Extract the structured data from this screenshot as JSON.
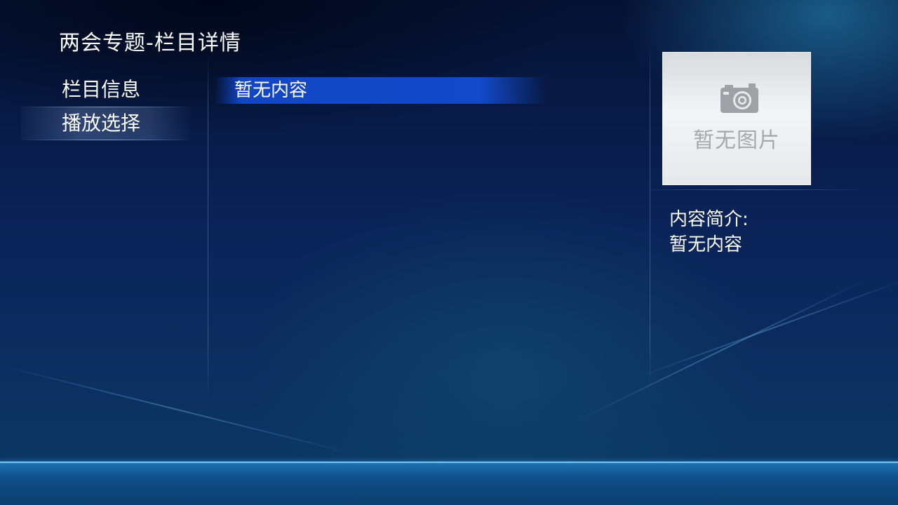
{
  "header": {
    "title": "两会专题-栏目详情"
  },
  "sidebar": {
    "items": [
      {
        "label": "栏目信息",
        "selected": false
      },
      {
        "label": "播放选择",
        "selected": true
      }
    ]
  },
  "content_list": {
    "items": [
      {
        "label": "暂无内容",
        "focused": true
      }
    ]
  },
  "detail": {
    "poster_placeholder_icon": "camera-icon",
    "poster_placeholder_text": "暂无图片",
    "description_label": "内容简介:",
    "description_value": "暂无内容"
  },
  "colors": {
    "background": "#0a2358",
    "highlight": "#1246c4",
    "text": "#ffffff",
    "placeholder_text": "#a6a8ac"
  }
}
